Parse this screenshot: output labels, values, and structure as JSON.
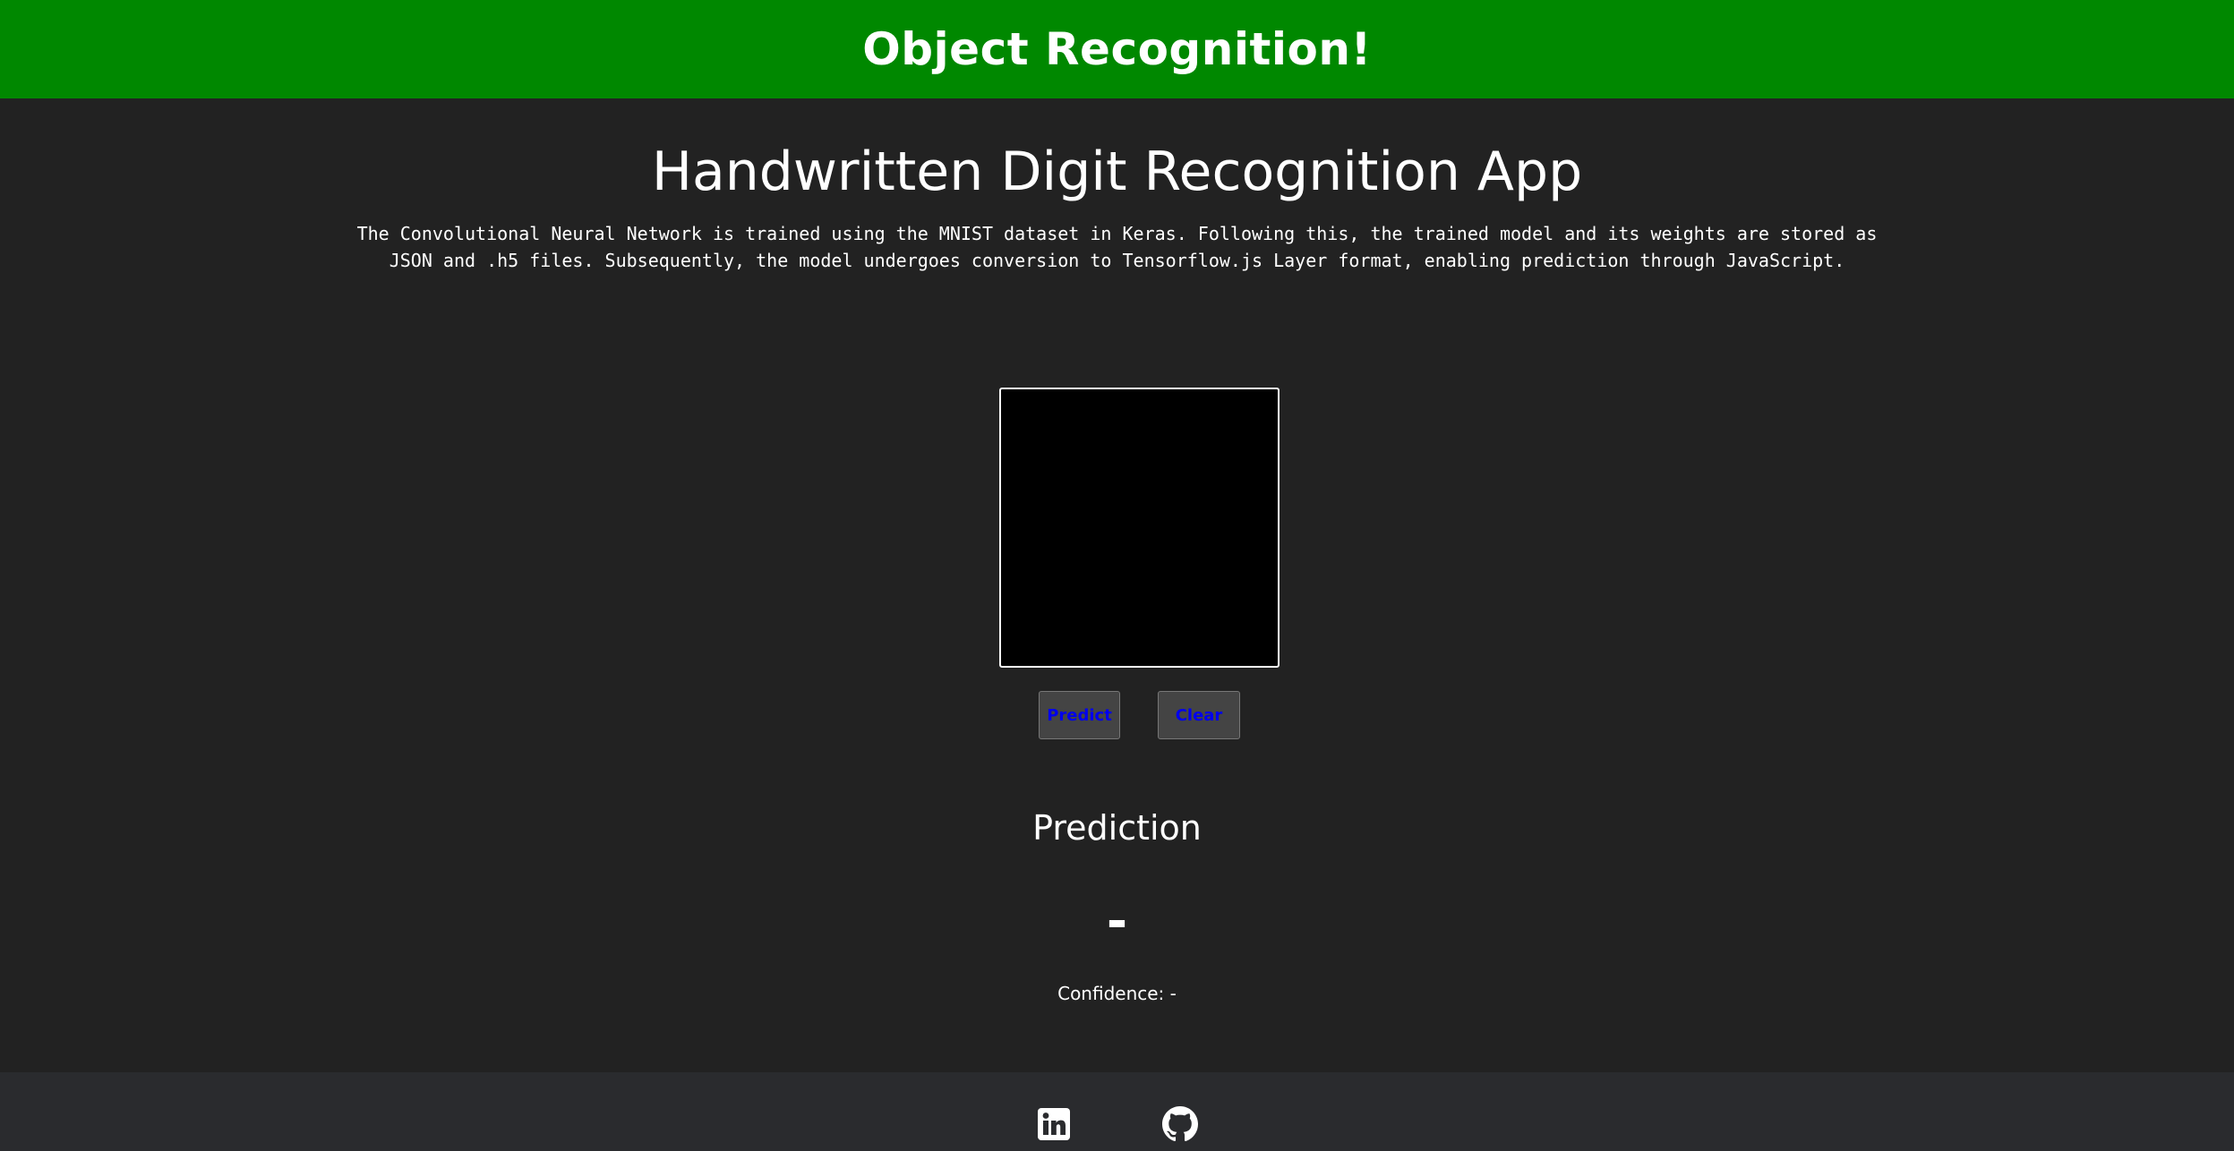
{
  "navbar": {
    "title": "Object Recognition!",
    "background_color": "#008800"
  },
  "main": {
    "title": "Handwritten Digit Recognition App",
    "description": "The Convolutional Neural Network is trained using the MNIST dataset in Keras. Following this, the trained model and its weights are stored as JSON and .h5 files. Subsequently, the model undergoes conversion to Tensorflow.js Layer format, enabling prediction through JavaScript."
  },
  "canvas": {
    "background_color": "#000000",
    "border_color": "#ffffff"
  },
  "buttons": {
    "predict_label": "Predict",
    "clear_label": "Clear",
    "text_color": "#0000ee"
  },
  "prediction": {
    "heading": "Prediction",
    "value": "-",
    "confidence": "Confidence: -"
  },
  "footer": {
    "icons": [
      "linkedin-icon",
      "github-icon"
    ]
  }
}
